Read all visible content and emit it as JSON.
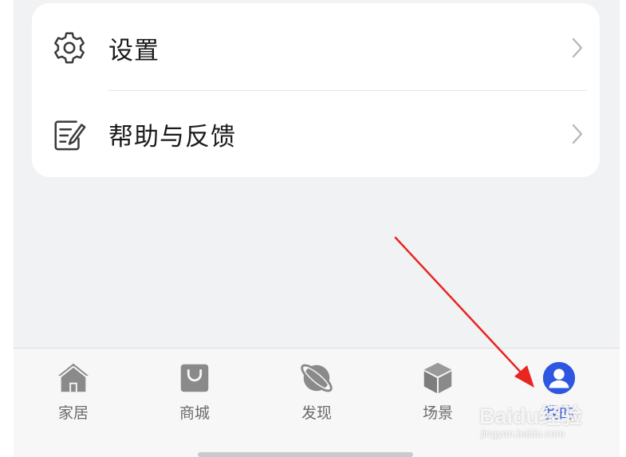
{
  "settings_card": {
    "items": [
      {
        "label": "设置",
        "icon": "gear-icon"
      },
      {
        "label": "帮助与反馈",
        "icon": "feedback-icon"
      }
    ]
  },
  "tabbar": {
    "tabs": [
      {
        "label": "家居",
        "icon": "home-icon"
      },
      {
        "label": "商城",
        "icon": "shopping-bag-icon"
      },
      {
        "label": "发现",
        "icon": "planet-icon"
      },
      {
        "label": "场景",
        "icon": "cube-icon"
      },
      {
        "label": "我的",
        "icon": "user-icon",
        "active": true
      }
    ]
  },
  "watermark": {
    "brand": "Baidu经验",
    "url": "jingyan.baidu.com"
  },
  "colors": {
    "background": "#f1f2f4",
    "card": "#ffffff",
    "accent": "#2f56e0",
    "inactive_icon": "#8a8a8a",
    "annotation_arrow": "#e8251f"
  }
}
